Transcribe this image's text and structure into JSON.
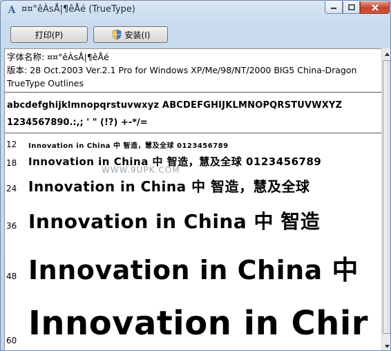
{
  "window": {
    "title": "¤¤°êÀsÅ|¶êÅé (TrueType)"
  },
  "toolbar": {
    "print_label": "打印(P)",
    "install_label": "安装(I)"
  },
  "info": {
    "name_line": "字体名称: ¤¤°êÀsÅ|¶êÅé",
    "version_line": "版本: 28 Oct.2003 Ver.2.1 Pro for Windows XP/Me/98/NT/2000 BIG5 China-Dragon",
    "type_line": "TrueType Outlines"
  },
  "charset": {
    "line1": "abcdefghijklmnopqrstuvwxyz  ABCDEFGHIJKLMNOPQRSTUVWXYZ",
    "line2": "1234567890.:,;  '  \"  (!?)  +-*/="
  },
  "samples": [
    {
      "size": "12",
      "text": "Innovation in China 中 智造，慧及全球 0123456789"
    },
    {
      "size": "18",
      "text": "Innovation in China 中 智造，慧及全球 0123456789"
    },
    {
      "size": "24",
      "text": "Innovation in China 中 智造，慧及全球"
    },
    {
      "size": "36",
      "text": "Innovation in China 中 智造"
    },
    {
      "size": "48",
      "text": "Innovation in China 中"
    },
    {
      "size": "60",
      "text": "Innovation in Chir"
    }
  ],
  "watermark": "WWW.9UPK.COM",
  "icons": [
    "app-font-icon",
    "minimize-icon",
    "maximize-icon",
    "close-icon",
    "shield-icon",
    "scroll-up-icon",
    "scroll-down-icon"
  ]
}
